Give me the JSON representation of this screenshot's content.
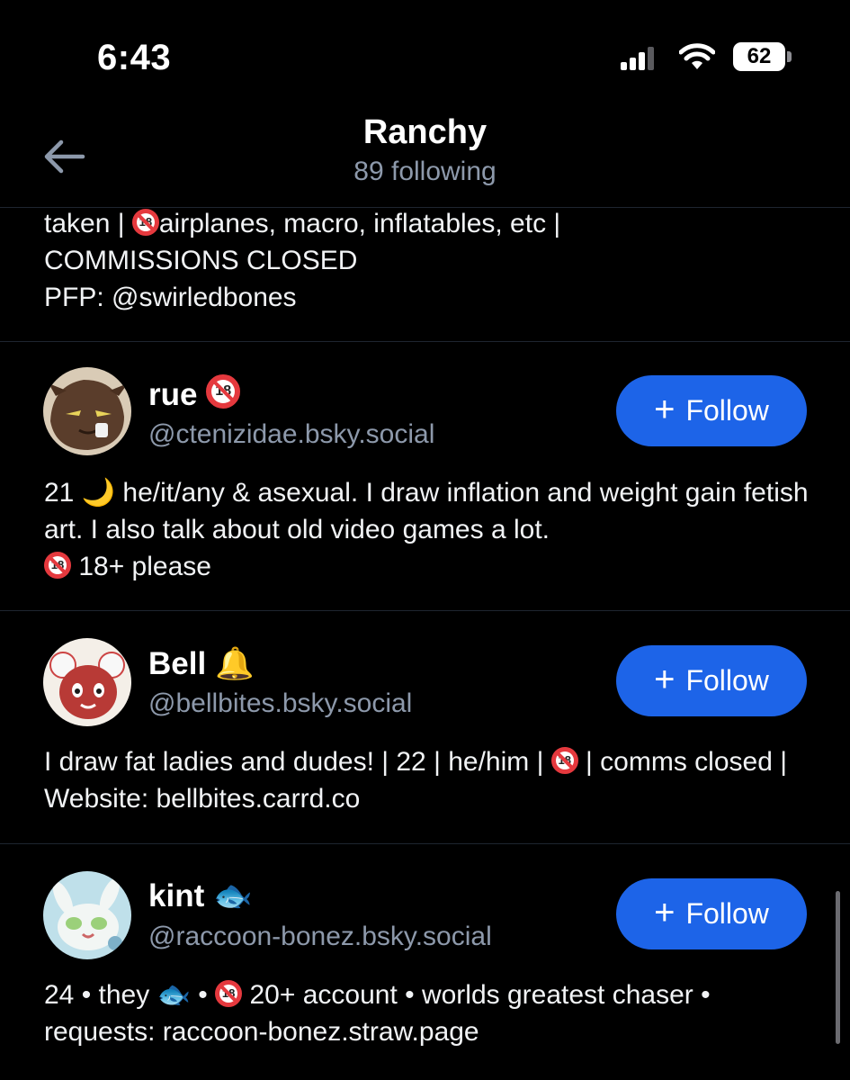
{
  "status_bar": {
    "time": "6:43",
    "battery": "62"
  },
  "header": {
    "title": "Ranchy",
    "subtitle": "89 following",
    "back_icon": "arrow-left-icon"
  },
  "previous_bio": {
    "line1_a": "taken | ",
    "line1_b": "airplanes, macro, inflatables, etc |",
    "line2": "COMMISSIONS CLOSED",
    "line3": "PFP: @swirledbones"
  },
  "follow_label": "Follow",
  "users": [
    {
      "name": "rue",
      "handle": "@ctenizidae.bsky.social",
      "bio_1": "21 ",
      "bio_moon": "🌙",
      "bio_2": " he/it/any & asexual. I draw inflation and weight gain fetish art. I also talk about old video games a lot.",
      "bio_3": " 18+ please"
    },
    {
      "name": "Bell",
      "name_emoji": "🔔",
      "handle": "@bellbites.bsky.social",
      "bio_1": "I draw fat ladies and dudes! | 22 | he/him | ",
      "bio_2": " | comms closed | Website: bellbites.carrd.co"
    },
    {
      "name": "kint",
      "name_emoji": "🐟",
      "handle": "@raccoon-bonez.bsky.social",
      "bio_1": "24 • they ",
      "bio_fish": "🐟",
      "bio_2": " • ",
      "bio_3": " 20+ account • worlds greatest chaser • requests: raccoon-bonez.straw.page"
    }
  ],
  "badge_18": "18"
}
